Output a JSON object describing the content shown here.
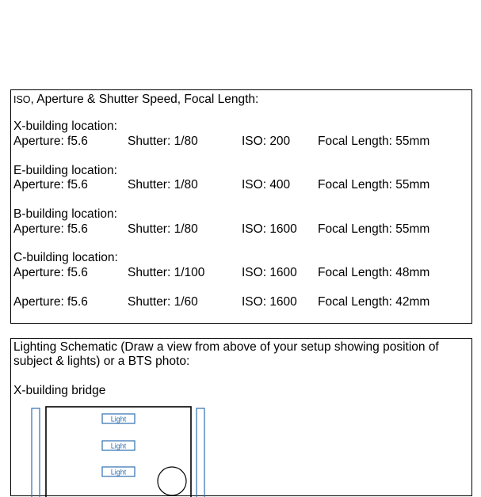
{
  "settings": {
    "heading_sc": "ISO",
    "heading_rest": ", Aperture & Shutter Speed, Focal Length:",
    "groups": [
      {
        "location": "X-building location:",
        "aperture": "Aperture: f5.6",
        "shutter": "Shutter: 1/80",
        "iso": "ISO: 200",
        "focal": "Focal Length: 55mm"
      },
      {
        "location": "E-building location:",
        "aperture": "Aperture: f5.6",
        "shutter": "Shutter: 1/80",
        "iso": "ISO: 400",
        "focal": "Focal Length: 55mm"
      },
      {
        "location": "B-building location:",
        "aperture": "Aperture: f5.6",
        "shutter": "Shutter: 1/80",
        "iso": "ISO: 1600",
        "focal": "Focal Length: 55mm"
      },
      {
        "location": "C-building location:",
        "aperture": "Aperture: f5.6",
        "shutter": "Shutter: 1/100",
        "iso": "ISO: 1600",
        "focal": "Focal Length: 48mm"
      },
      {
        "location": "",
        "aperture": "Aperture: f5.6",
        "shutter": "Shutter: 1/60",
        "iso": "ISO: 1600",
        "focal": "Focal Length: 42mm"
      }
    ]
  },
  "lighting": {
    "heading": "Lighting Schematic (Draw a view from above of your setup showing position of subject & lights) or a BTS photo:",
    "subheading": "X-building bridge",
    "schematic": {
      "light_labels": [
        "Light",
        "Light",
        "Light"
      ],
      "partial_label": "",
      "colors": {
        "outline": "#2f6fb0",
        "frame": "#000000"
      }
    }
  }
}
